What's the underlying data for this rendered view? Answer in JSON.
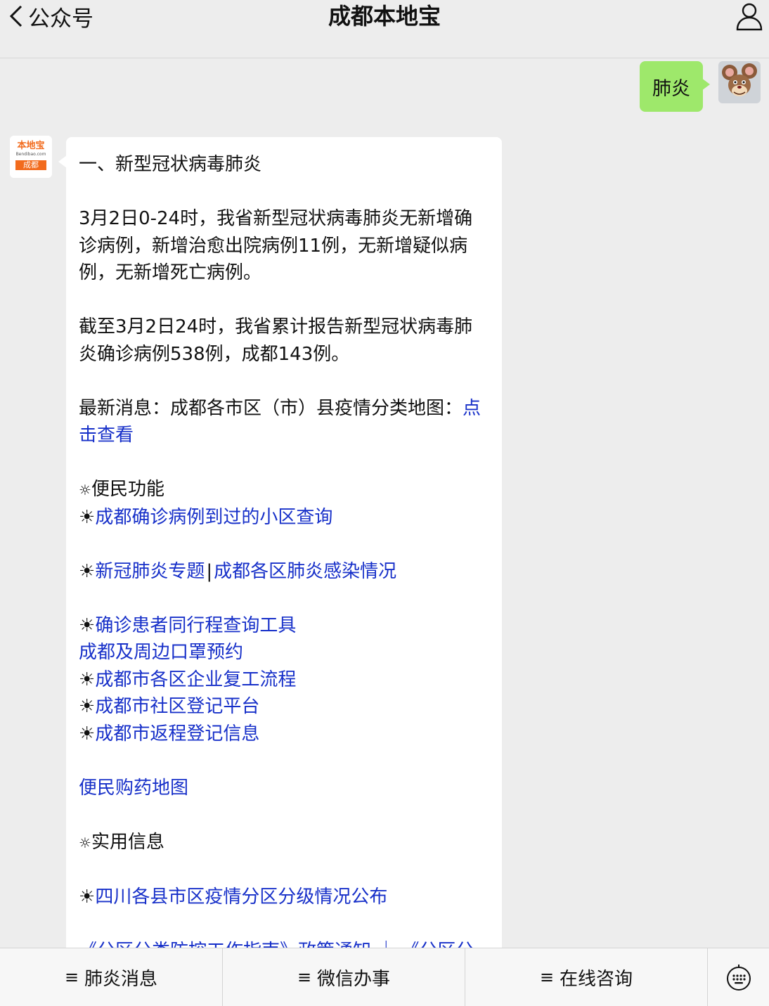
{
  "header": {
    "back_label": "公众号",
    "title": "成都本地宝"
  },
  "chat": {
    "user_message": "肺炎",
    "bot_logo": {
      "top_text": "本地宝",
      "site": "Bendibao.com",
      "city": "成都"
    },
    "article": {
      "heading": "一、新型冠状病毒肺炎",
      "para1": "3月2日0-24时，我省新型冠状病毒肺炎无新增确诊病例，新增治愈出院病例11例，无新增疑似病例，无新增死亡病例。",
      "para2": "截至3月2日24时，我省累计报告新型冠状病毒肺炎确诊病例538例，成都143例。",
      "latest_prefix": "最新消息：成都各市区（市）县疫情分类地图：",
      "latest_link": "点击查看",
      "section1_marker": "☼",
      "section1_title": "便民功能",
      "bullet": "☀",
      "link_community": "成都确诊病例到过的小区查询",
      "link_topic": "新冠肺炎专题",
      "separator": "|",
      "link_districts": "成都各区肺炎感染情况",
      "link_trip_tool": "确诊患者同行程查询工具",
      "link_masks": "成都及周边口罩预约",
      "link_resume_work": "成都市各区企业复工流程",
      "link_community_register": "成都市社区登记平台",
      "link_return_register": "成都市返程登记信息",
      "link_medicine_map": "便民购药地图",
      "section2_title": "实用信息",
      "link_sichuan_zones": "四川各县市区疫情分区分级情况公布",
      "cut_line": "《分区分类防控工作指南》政策通知 ｜ 《分区分"
    }
  },
  "menu": {
    "items": [
      "肺炎消息",
      "微信办事",
      "在线咨询"
    ],
    "menu_icon": "≡"
  },
  "colors": {
    "background": "#ededed",
    "user_bubble": "#9ee86b",
    "link": "#1730c9",
    "logo_orange": "#f26b1d"
  }
}
